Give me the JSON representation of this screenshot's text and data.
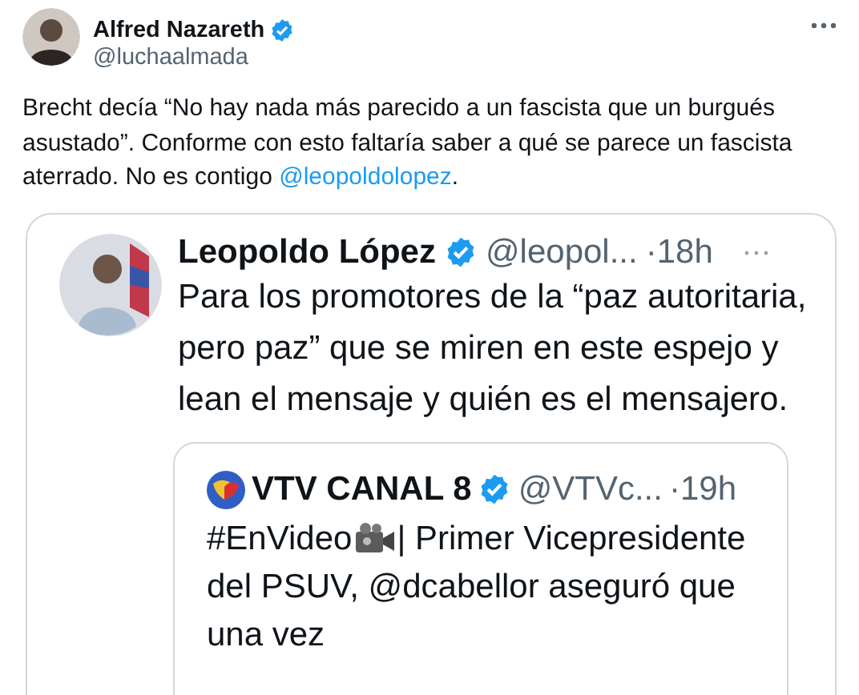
{
  "author": {
    "name": "Alfred Nazareth",
    "verified": true,
    "handle": "@luchaalmada"
  },
  "body": [
    {
      "kind": "text",
      "text": "Brecht decía “No hay nada más parecido a un fascista que un burgués asustado”.  Conforme con esto faltaría saber a qué se parece un fascista aterrado. No es contigo "
    },
    {
      "kind": "mention",
      "text": "@leopoldolopez"
    },
    {
      "kind": "text",
      "text": "."
    }
  ],
  "quoted": {
    "name": "Leopoldo López",
    "verified": true,
    "handle": "@leopol...",
    "time": "·18h",
    "text": "Para los promotores de la “paz autoritaria, pero paz” que se miren en este espejo y lean el mensaje y quién es el mensajero.",
    "quoted": {
      "name": "VTV CANAL 8",
      "verified": true,
      "handle": "@VTVc...",
      "time": "·19h",
      "parts": [
        {
          "kind": "text",
          "text": "#EnVideo"
        },
        {
          "kind": "camera"
        },
        {
          "kind": "text",
          "text": "| Primer Vicepresidente del PSUV, @dcabellor aseguró que una vez"
        }
      ]
    }
  }
}
